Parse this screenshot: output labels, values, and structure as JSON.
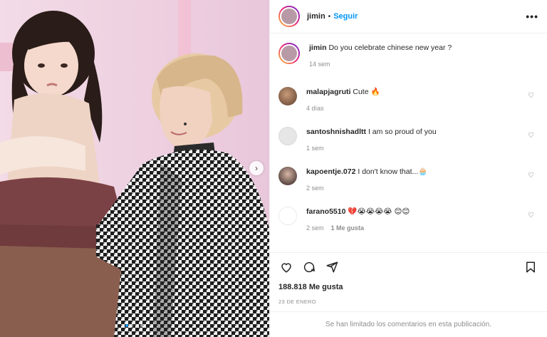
{
  "post": {
    "author": "jimin",
    "separator": "•",
    "follow_label": "Seguir",
    "more_label": "•••",
    "caption": {
      "user": "jimin",
      "text": "Do you celebrate chinese new year ?",
      "time": "14 sem"
    },
    "comments": [
      {
        "user": "malapjagruti",
        "text": "Cute 🔥",
        "time": "4 días",
        "likes": ""
      },
      {
        "user": "santoshnishadltt",
        "text": "I am so proud of you",
        "time": "1 sem",
        "likes": ""
      },
      {
        "user": "kapoentje.072",
        "text": "I don't know that...🧁",
        "time": "2 sem",
        "likes": ""
      },
      {
        "user": "farano5510",
        "text": "💔😭😭😭😭 😊😊",
        "time": "2 sem",
        "likes": "1 Me gusta"
      }
    ],
    "likes_count": "188.818 Me gusta",
    "date": "23 DE ENERO",
    "comments_limited": "Se han limitado los comentarios en esta publicación."
  },
  "icons": {
    "heart": "heart-icon",
    "comment": "comment-icon",
    "share": "paper-plane-icon",
    "save": "bookmark-icon",
    "next": "chevron-right-icon"
  },
  "colors": {
    "accent": "#0095f6",
    "muted": "#8e8e8e",
    "text": "#262626"
  }
}
